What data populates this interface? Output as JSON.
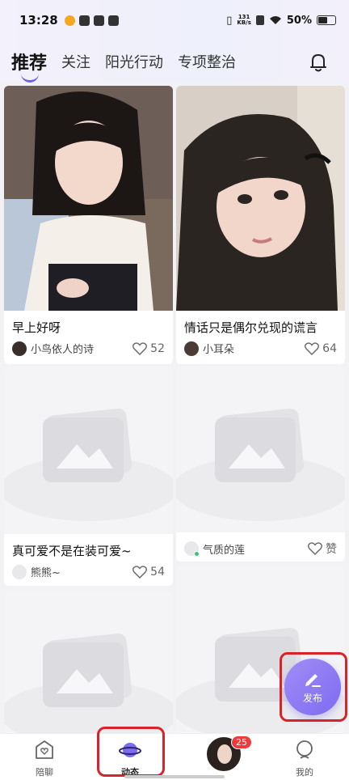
{
  "status": {
    "time": "13:28",
    "net_speed": "131",
    "net_unit": "KB/s",
    "battery": "50%"
  },
  "tabs": [
    "推荐",
    "关注",
    "阳光行动",
    "专项整治"
  ],
  "posts": [
    {
      "title": "早上好呀",
      "author": "小鸟依人的诗",
      "likes": "52"
    },
    {
      "title": "情话只是偶尔兑现的谎言",
      "author": "小耳朵",
      "likes": "64"
    },
    {
      "title": "真可爱不是在装可爱~",
      "author": "熊熊~",
      "likes": "54"
    },
    {
      "title": "",
      "author": "气质的莲",
      "likes": "赞"
    }
  ],
  "fab": {
    "label": "发布"
  },
  "nav": {
    "items": [
      {
        "label": "陪聊"
      },
      {
        "label": "动态"
      },
      {
        "label": ""
      },
      {
        "label": "我的"
      }
    ],
    "badge": "25"
  },
  "colors": {
    "accent": "#7c6cf0",
    "highlight": "#d8232a"
  }
}
